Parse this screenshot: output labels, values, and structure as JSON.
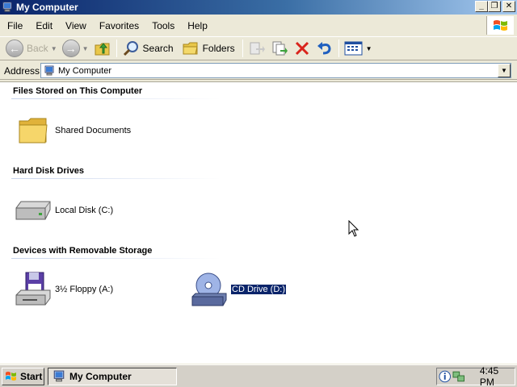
{
  "window": {
    "title": "My Computer",
    "buttons": {
      "minimize": "_",
      "restore": "❐",
      "close": "✕"
    }
  },
  "menu": {
    "items": [
      "File",
      "Edit",
      "View",
      "Favorites",
      "Tools",
      "Help"
    ]
  },
  "toolbar": {
    "back_label": "Back",
    "search_label": "Search",
    "folders_label": "Folders"
  },
  "address": {
    "label": "Address",
    "value": "My Computer"
  },
  "groups": [
    {
      "title": "Files Stored on This Computer",
      "items": [
        {
          "label": "Shared Documents",
          "icon": "folder-icon"
        }
      ]
    },
    {
      "title": "Hard Disk Drives",
      "items": [
        {
          "label": "Local Disk (C:)",
          "icon": "hard-disk-icon"
        }
      ]
    },
    {
      "title": "Devices with Removable Storage",
      "items": [
        {
          "label": "3½ Floppy (A:)",
          "icon": "floppy-drive-icon"
        },
        {
          "label": "CD Drive (D:)",
          "icon": "cd-drive-icon",
          "selected": true
        }
      ]
    }
  ],
  "taskbar": {
    "start_label": "Start",
    "task_label": "My Computer",
    "clock": "4:45 PM"
  },
  "colors": {
    "title_gradient_start": "#0a246a",
    "selection": "#0a246a",
    "chrome": "#ece9d8"
  }
}
